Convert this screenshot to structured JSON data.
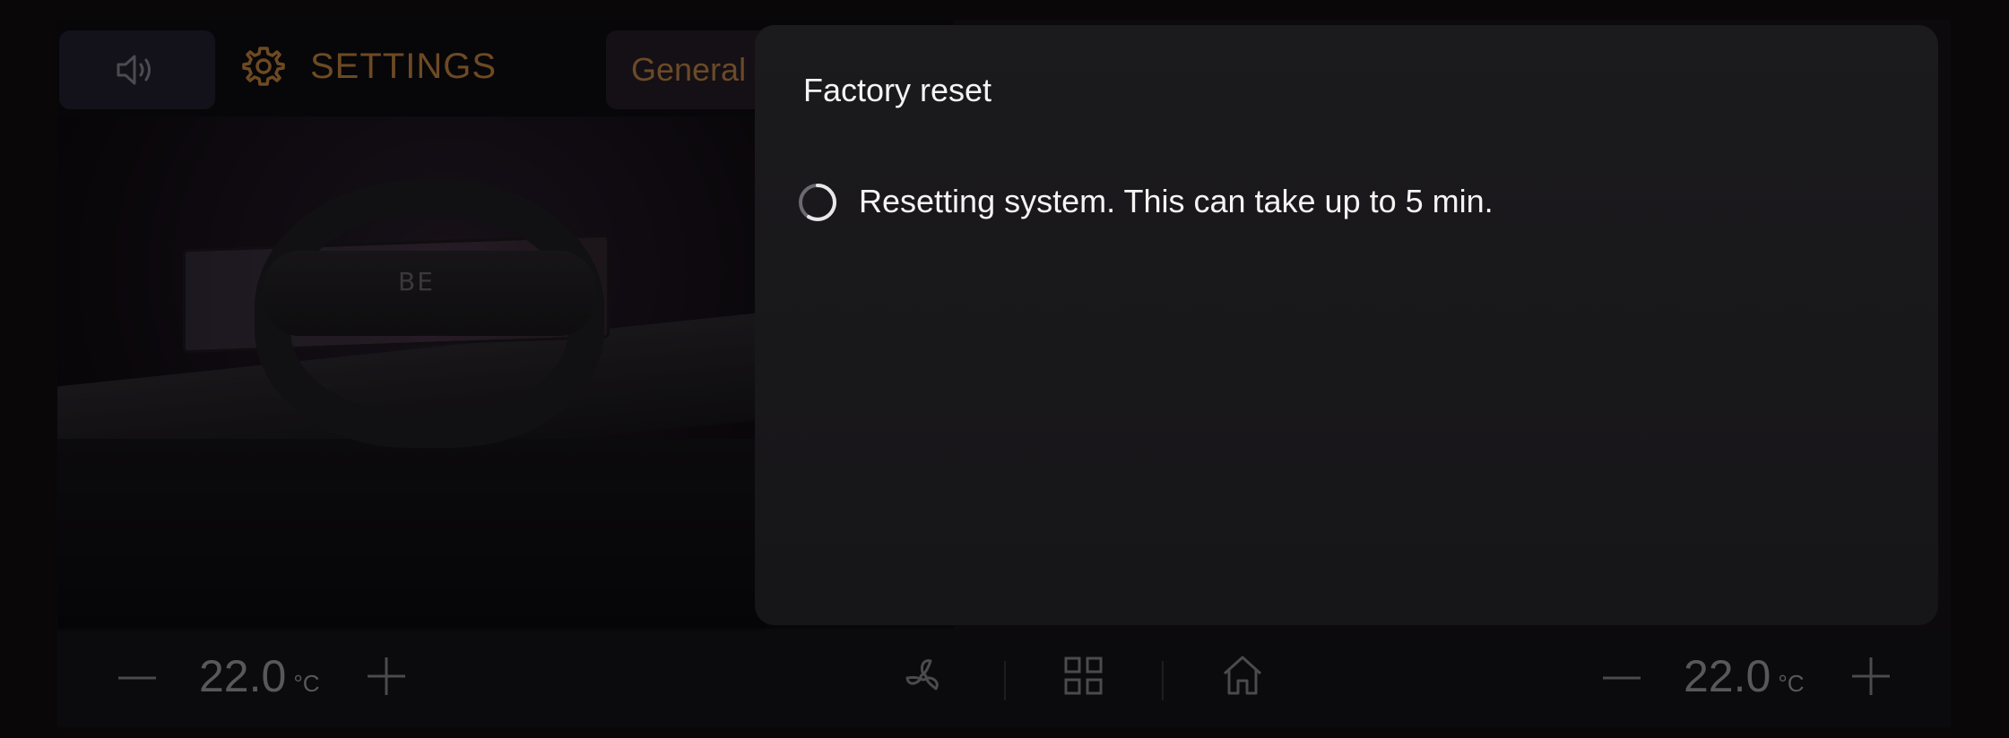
{
  "header": {
    "title": "SETTINGS",
    "tab_general": "General"
  },
  "scene": {
    "wheel_logo": "BE"
  },
  "dialog": {
    "title": "Factory reset",
    "message": "Resetting system. This can take up to 5 min."
  },
  "climate": {
    "left_temp": "22.0",
    "left_unit": "°C",
    "right_temp": "22.0",
    "right_unit": "°C"
  },
  "icons": {
    "volume": "volume-icon",
    "settings": "gear-icon",
    "spinner": "loading-spinner-icon",
    "fan": "fan-icon",
    "apps": "apps-grid-icon",
    "home": "home-icon",
    "minus": "minus-icon",
    "plus": "plus-icon"
  },
  "colors": {
    "accent": "#c97a2e",
    "dialog_bg": "#1a191c",
    "text": "#f4f4f4"
  }
}
